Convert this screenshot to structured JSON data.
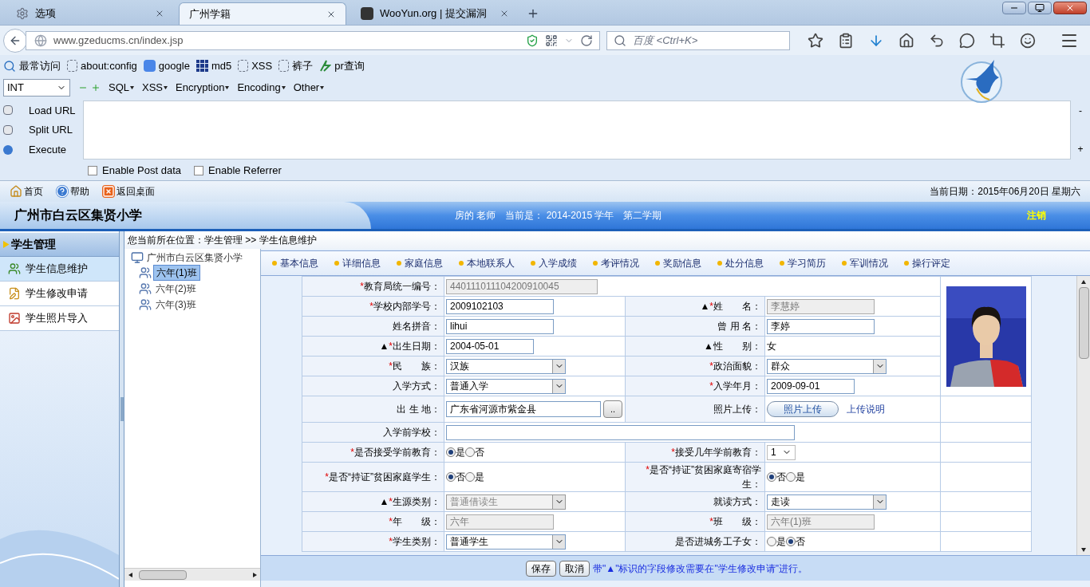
{
  "browser": {
    "tabs": [
      {
        "label": "选项",
        "kind": "settings",
        "selected": false
      },
      {
        "label": "广州学籍",
        "kind": "page",
        "selected": true
      },
      {
        "label": "WooYun.org | 提交漏洞",
        "kind": "site",
        "selected": false
      }
    ],
    "url": "www.gzeducms.cn/index.jsp",
    "search": {
      "placeholder": "百度 <Ctrl+K>"
    },
    "bookmarks": [
      {
        "label": "最常访问",
        "kind": "search"
      },
      {
        "label": "about:config",
        "kind": "blank"
      },
      {
        "label": "google",
        "kind": "google"
      },
      {
        "label": "md5",
        "kind": "grid"
      },
      {
        "label": "XSS",
        "kind": "blank"
      },
      {
        "label": "裤子",
        "kind": "blank"
      },
      {
        "label": "pr查询",
        "kind": "pr"
      }
    ]
  },
  "hackbar": {
    "select": "INT",
    "menus": [
      "SQL",
      "XSS",
      "Encryption",
      "Encoding",
      "Other"
    ],
    "actions": [
      "Load URL",
      "Split URL",
      "Execute"
    ],
    "side_marks": [
      "-",
      "+"
    ],
    "options": [
      {
        "label": "Enable Post data",
        "checked": false
      },
      {
        "label": "Enable Referrer",
        "checked": false
      }
    ]
  },
  "app": {
    "toolbar": [
      {
        "label": "首页",
        "kind": "home"
      },
      {
        "label": "帮助",
        "kind": "help"
      },
      {
        "label": "返回桌面",
        "kind": "exit"
      }
    ],
    "date": "当前日期：2015年06月20日 星期六",
    "school": "广州市白云区集贤小学",
    "user_info": "房的 老师　当前是： 2014-2015 学年　第二学期",
    "logout": "注销",
    "sidebar": {
      "title": "学生管理",
      "items": [
        {
          "label": "学生信息维护",
          "selected": true
        },
        {
          "label": "学生修改申请",
          "selected": false
        },
        {
          "label": "学生照片导入",
          "selected": false
        }
      ]
    },
    "breadcrumb": "您当前所在位置：学生管理 >> 学生信息维护",
    "tree": {
      "label": "广州市白云区集贤小学",
      "children": [
        {
          "label": "六年(1)班",
          "selected": true
        },
        {
          "label": "六年(2)班",
          "selected": false
        },
        {
          "label": "六年(3)班",
          "selected": false
        }
      ]
    },
    "tabs": [
      "基本信息",
      "详细信息",
      "家庭信息",
      "本地联系人",
      "入学成绩",
      "考评情况",
      "奖励信息",
      "处分信息",
      "学习简历",
      "军训情况",
      "操行评定"
    ],
    "form": {
      "rows": [
        {
          "cells": [
            {
              "star": "*",
              "label": "教育局统一编号：",
              "field": {
                "kind": "text",
                "value": "440111011104200910045",
                "disabled": true
              }
            }
          ]
        },
        {
          "cells": [
            {
              "star": "*",
              "label": "学校内部学号：",
              "field": {
                "kind": "text",
                "value": "2009102103",
                "disabled": false
              }
            },
            {
              "prefix": "▲",
              "star": "*",
              "label": "姓　　名：",
              "field": {
                "kind": "text",
                "value": "李慧婷",
                "disabled": true
              }
            }
          ]
        },
        {
          "cells": [
            {
              "label": "姓名拼音：",
              "field": {
                "kind": "text",
                "value": "lihui",
                "disabled": false
              }
            },
            {
              "label": "曾 用 名：",
              "field": {
                "kind": "text",
                "value": "李婷",
                "disabled": false
              }
            }
          ]
        },
        {
          "cells": [
            {
              "prefix": "▲",
              "star": "*",
              "label": "出生日期：",
              "field": {
                "kind": "date",
                "value": "2004-05-01",
                "disabled": false
              }
            },
            {
              "prefix": "▲",
              "label": "性　　别：",
              "field": {
                "kind": "static",
                "value": "女"
              }
            }
          ]
        },
        {
          "cells": [
            {
              "star": "*",
              "label": "民　　族：",
              "field": {
                "kind": "select",
                "value": "汉族",
                "disabled": false
              }
            },
            {
              "star": "*",
              "label": "政治面貌：",
              "field": {
                "kind": "select",
                "value": "群众",
                "disabled": false
              }
            }
          ]
        },
        {
          "cells": [
            {
              "label": "入学方式：",
              "field": {
                "kind": "select",
                "value": "普通入学",
                "disabled": false
              }
            },
            {
              "star": "*",
              "label": "入学年月：",
              "field": {
                "kind": "date",
                "value": "2009-09-01",
                "disabled": false
              }
            }
          ]
        },
        {
          "cells": [
            {
              "label": "出 生 地：",
              "field": {
                "kind": "browse",
                "value": "广东省河源市紫金县",
                "button": ".."
              }
            },
            {
              "label": "照片上传：",
              "field": {
                "kind": "upload",
                "button": "照片上传",
                "link": "上传说明"
              }
            }
          ]
        },
        {
          "cells": [
            {
              "label": "入学前学校：",
              "field": {
                "kind": "text",
                "disabled": false
              }
            }
          ]
        },
        {
          "cells": [
            {
              "star": "*",
              "label": "是否接受学前教育：",
              "field": {
                "kind": "radio",
                "options": [
                  {
                    "label": "是",
                    "selected": true
                  },
                  {
                    "label": "否",
                    "selected": false
                  }
                ]
              }
            },
            {
              "star": "*",
              "label": "接受几年学前教育：",
              "field": {
                "kind": "small-select",
                "value": "1"
              }
            }
          ]
        },
        {
          "cells": [
            {
              "star": "*",
              "label": "是否“持证”贫困家庭学生：",
              "field": {
                "kind": "radio",
                "options": [
                  {
                    "label": "否",
                    "selected": true
                  },
                  {
                    "label": "是",
                    "selected": false
                  }
                ]
              }
            },
            {
              "star": "*",
              "label": "是否“持证”贫困家庭寄宿学生：",
              "field": {
                "kind": "radio",
                "options": [
                  {
                    "label": "否",
                    "selected": true
                  },
                  {
                    "label": "是",
                    "selected": false
                  }
                ]
              }
            }
          ]
        },
        {
          "cells": [
            {
              "prefix": "▲",
              "star": "*",
              "label": "生源类别：",
              "field": {
                "kind": "select",
                "value": "普通借读生",
                "disabled": true
              }
            },
            {
              "label": "就读方式：",
              "field": {
                "kind": "select",
                "value": "走读",
                "disabled": false
              }
            }
          ]
        },
        {
          "cells": [
            {
              "star": "*",
              "label": "年　　级：",
              "field": {
                "kind": "text",
                "value": "六年",
                "disabled": true
              }
            },
            {
              "star": "*",
              "label": "班　　级：",
              "field": {
                "kind": "text",
                "value": "六年(1)班",
                "disabled": true
              }
            }
          ]
        },
        {
          "cells": [
            {
              "star": "*",
              "label": "学生类别：",
              "field": {
                "kind": "select",
                "value": "普通学生",
                "disabled": false
              }
            },
            {
              "label": "是否进城务工子女：",
              "field": {
                "kind": "radio",
                "options": [
                  {
                    "label": "是",
                    "selected": false
                  },
                  {
                    "label": "否",
                    "selected": true
                  }
                ]
              }
            }
          ]
        }
      ]
    },
    "buttons": [
      "保存",
      "取消"
    ],
    "note": "带\"▲\"标识的字段修改需要在\"学生修改申请\"进行。"
  }
}
